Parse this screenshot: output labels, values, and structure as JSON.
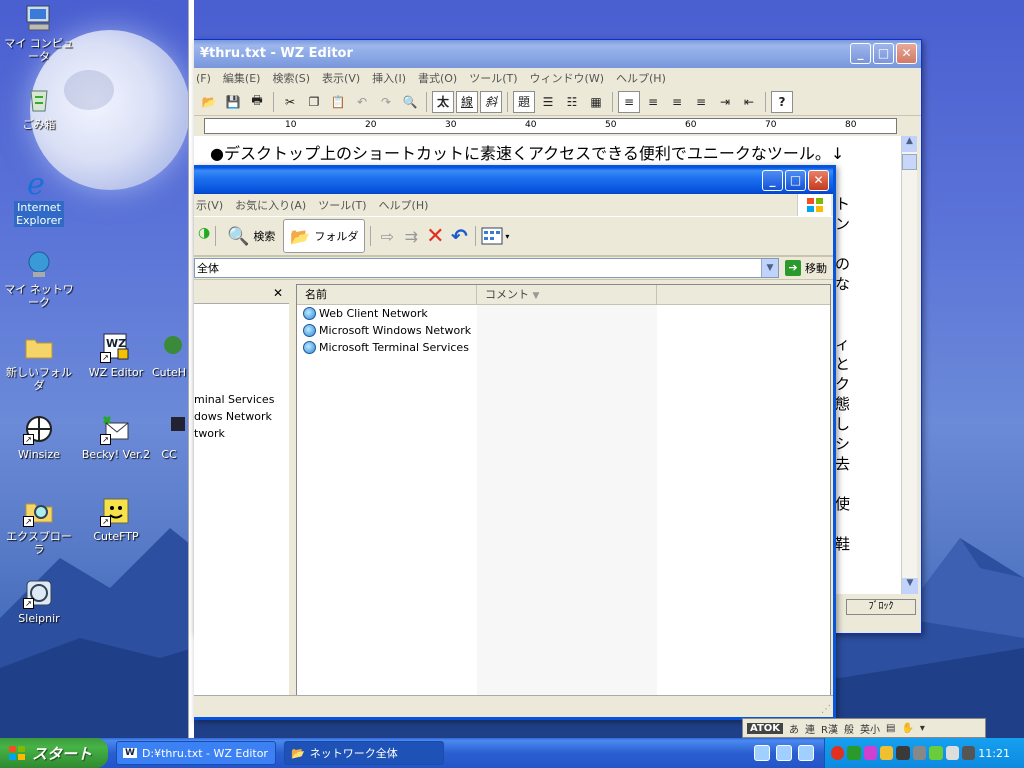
{
  "desktop": {
    "icons": [
      {
        "label": "マイ コンピュータ",
        "icon": "my-computer-icon"
      },
      {
        "label": "ごみ箱",
        "icon": "recycle-bin-icon"
      },
      {
        "label": "Internet Explorer",
        "icon": "internet-explorer-icon"
      },
      {
        "label": "マイ ネットワーク",
        "icon": "my-network-icon"
      },
      {
        "label": "新しいフォルダ",
        "icon": "folder-icon"
      },
      {
        "label": "WZ Editor",
        "icon": "wz-editor-icon"
      },
      {
        "label": "CuteH",
        "icon": "cutehtml-icon"
      },
      {
        "label": "Winsize",
        "icon": "winsize-icon"
      },
      {
        "label": "Becky! Ver.2",
        "icon": "becky-mail-icon"
      },
      {
        "label": "CC",
        "icon": "cc-icon"
      },
      {
        "label": "エクスプローラ",
        "icon": "explorer-icon"
      },
      {
        "label": "CuteFTP",
        "icon": "cuteftp-icon"
      },
      {
        "label": "Sleipnir",
        "icon": "sleipnir-icon"
      }
    ]
  },
  "wz": {
    "title": "¥thru.txt - WZ Editor",
    "menu": [
      "(F)",
      "編集(E)",
      "検索(S)",
      "表示(V)",
      "挿入(I)",
      "書式(O)",
      "ツール(T)",
      "ウィンドウ(W)",
      "ヘルプ(H)"
    ],
    "toolbar": {
      "bold": "太",
      "underline": "線",
      "italic": "斜",
      "heading": "題"
    },
    "ruler": [
      "10",
      "20",
      "30",
      "40",
      "50",
      "60",
      "70",
      "80"
    ],
    "first_line": "●デスクトップ上のショートカットに素速くアクセスできる便利でユニークなツール。↓",
    "right_chars": [
      "ト",
      "ン",
      "の",
      "な",
      "ィ",
      "と",
      "ク",
      "態",
      "し",
      "シ",
      "去",
      "使",
      "鞋"
    ],
    "status_block": "ﾌﾞﾛｯｸ"
  },
  "explorer": {
    "menu": [
      "示(V)",
      "お気に入り(A)",
      "ツール(T)",
      "ヘルプ(H)"
    ],
    "toolbar": {
      "search": "検索",
      "folders": "フォルダ"
    },
    "address": "全体",
    "go": "移動",
    "tree_items": [
      "minal Services",
      "dows Network",
      "twork"
    ],
    "columns": {
      "name": "名前",
      "comment": "コメント"
    },
    "rows": [
      "Web Client Network",
      "Microsoft Windows Network",
      "Microsoft Terminal Services"
    ]
  },
  "ime": {
    "label": "ATOK",
    "chars": [
      "あ",
      "連",
      "R漢",
      "般",
      "英小"
    ]
  },
  "taskbar": {
    "start": "スタート",
    "tasks": [
      "D:¥thru.txt - WZ Editor",
      "ネットワーク全体"
    ],
    "clock": "11:21"
  }
}
